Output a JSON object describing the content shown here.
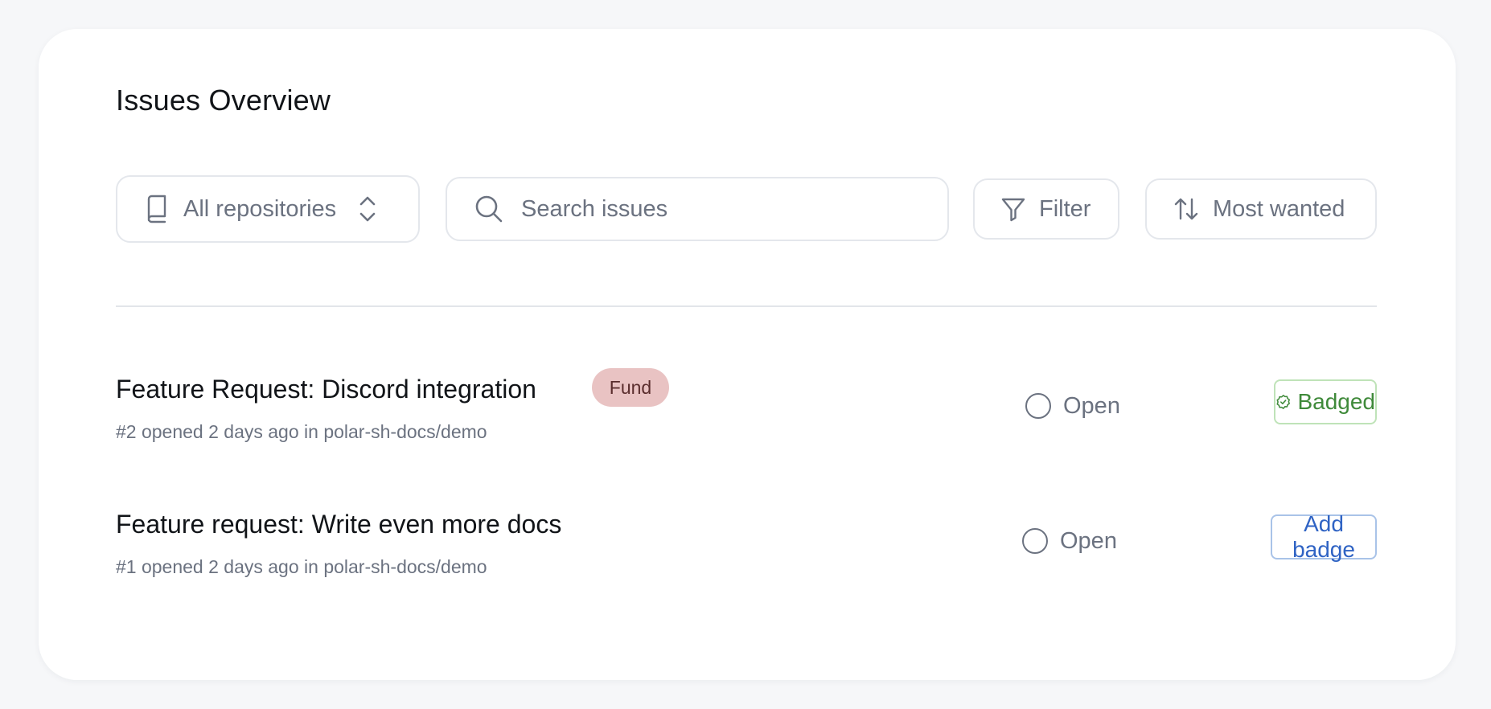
{
  "page": {
    "title": "Issues Overview"
  },
  "toolbar": {
    "repository_select": {
      "icon": "book-icon",
      "label": "All repositories",
      "chevron_icon": "chevron-up-down-icon"
    },
    "search": {
      "icon": "search-icon",
      "placeholder": "Search issues",
      "value": ""
    },
    "filter": {
      "icon": "filter-icon",
      "label": "Filter"
    },
    "sort": {
      "icon": "sort-arrows-icon",
      "label": "Most wanted"
    }
  },
  "issues": [
    {
      "title": "Feature Request: Discord integration",
      "tag": "Fund",
      "meta": "#2 opened 2 days ago in polar-sh-docs/demo",
      "status": "Open",
      "status_icon": "open-circle-icon",
      "action": {
        "label": "Badged",
        "icon": "badge-check-icon"
      }
    },
    {
      "title": "Feature request: Write even more docs",
      "meta": "#1 opened 2 days ago in polar-sh-docs/demo",
      "status": "Open",
      "status_icon": "open-circle-icon",
      "action": {
        "label": "Add badge"
      }
    }
  ],
  "colors": {
    "background": "#f6f7f9",
    "card": "#ffffff",
    "text_primary": "#111418",
    "text_muted": "#6b7280",
    "fund_badge_bg": "#e9c3c3",
    "badged_green": "#3f8a3a",
    "add_badge_blue": "#2f63c4"
  }
}
